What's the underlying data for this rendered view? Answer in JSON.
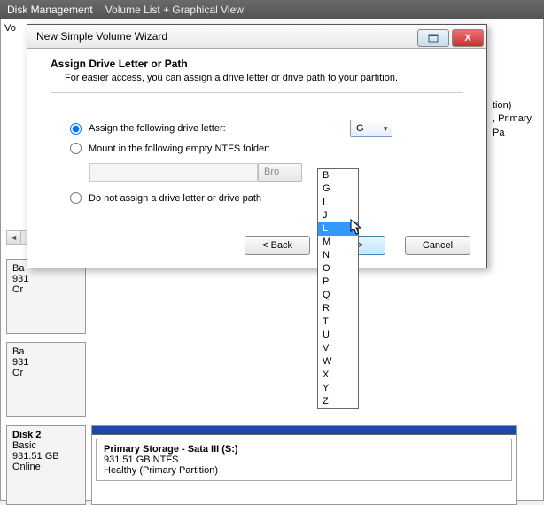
{
  "bg": {
    "title": "Disk Management",
    "subtitle": "Volume List + Graphical View",
    "vol_col": "Vo",
    "side_info_l1": "tion)",
    "side_info_l2": ", Primary Pa",
    "disks": [
      {
        "name": "",
        "type": "Ba",
        "size": "931",
        "status": "Or"
      },
      {
        "name": "",
        "type": "Ba",
        "size": "931",
        "status": "Or"
      },
      {
        "name": "Disk 2",
        "type": "Basic",
        "size": "931.51 GB",
        "status": "Online"
      }
    ],
    "disk2_vol": {
      "name": "Primary Storage - Sata III  (S:)",
      "details": "931.51 GB NTFS",
      "health": "Healthy (Primary Partition)"
    }
  },
  "dialog": {
    "title": "New Simple Volume Wizard",
    "heading": "Assign Drive Letter or Path",
    "sub": "For easier access, you can assign a drive letter or drive path to your partition.",
    "opt1": "Assign the following drive letter:",
    "opt2": "Mount in the following empty NTFS folder:",
    "opt3": "Do not assign a drive letter or drive path",
    "selected_letter": "G",
    "browse": "Bro",
    "btn_back": "< Back",
    "btn_next": "ext >",
    "btn_cancel": "Cancel"
  },
  "dropdown": {
    "highlighted": "L",
    "items": [
      "B",
      "G",
      "I",
      "J",
      "L",
      "M",
      "N",
      "O",
      "P",
      "Q",
      "R",
      "T",
      "U",
      "V",
      "W",
      "X",
      "Y",
      "Z"
    ]
  }
}
